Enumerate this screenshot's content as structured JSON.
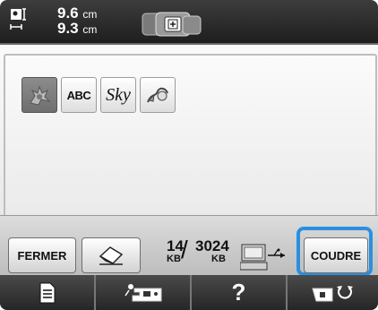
{
  "header": {
    "width_value": "9.6",
    "width_unit": "cm",
    "height_value": "9.3",
    "height_unit": "cm",
    "embroidery_size_icon": "embroidery-size-icon",
    "frame_icon": "hoop-frame-icon"
  },
  "categories": [
    {
      "icon": "floral-pattern-icon",
      "selected": true
    },
    {
      "label": "ABC",
      "selected": false
    },
    {
      "label": "Sky",
      "selected": false
    },
    {
      "icon": "border-pattern-icon",
      "selected": false
    }
  ],
  "bottom": {
    "close_label": "FERMER",
    "eraser_icon": "eraser-icon",
    "memory_used": "14",
    "memory_total": "3024",
    "memory_unit": "KB",
    "computer_icon": "usb-computer-icon",
    "sew_label": "COUDRE",
    "highlight_color": "#2a8fe0"
  },
  "tabs": [
    {
      "icon": "page-list-icon"
    },
    {
      "icon": "sewing-machine-icon"
    },
    {
      "label": "?"
    },
    {
      "icon": "settings-icon"
    }
  ]
}
